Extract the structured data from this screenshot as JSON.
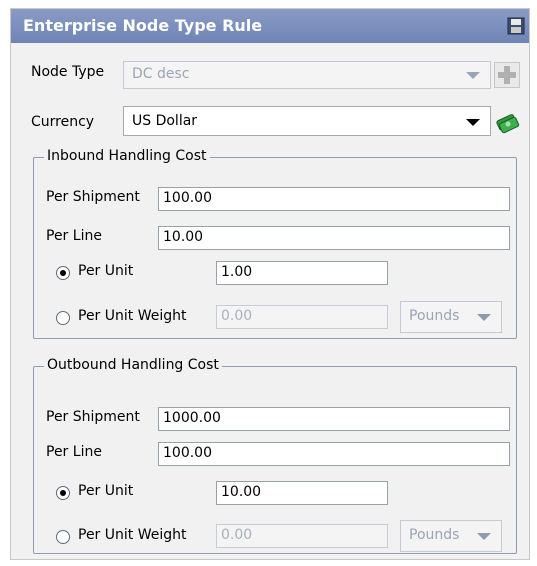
{
  "title": "Enterprise Node Type Rule",
  "node_type": {
    "label": "Node Type",
    "value": "DC desc"
  },
  "currency": {
    "label": "Currency",
    "value": "US Dollar"
  },
  "inbound": {
    "legend": "Inbound Handling Cost",
    "per_shipment_label": "Per Shipment",
    "per_shipment_value": "100.00",
    "per_line_label": "Per Line",
    "per_line_value": "10.00",
    "per_unit_label": "Per Unit",
    "per_unit_value": "1.00",
    "per_unit_weight_label": "Per Unit Weight",
    "per_unit_weight_value": "0.00",
    "weight_unit": "Pounds"
  },
  "outbound": {
    "legend": "Outbound Handling Cost",
    "per_shipment_label": "Per Shipment",
    "per_shipment_value": "1000.00",
    "per_line_label": "Per Line",
    "per_line_value": "100.00",
    "per_unit_label": "Per Unit",
    "per_unit_value": "10.00",
    "per_unit_weight_label": "Per Unit Weight",
    "per_unit_weight_value": "0.00",
    "weight_unit": "Pounds"
  },
  "colors": {
    "titlebar": "#7a8dbd",
    "panel": "#f1f1f1",
    "group_border": "#8e9db3"
  }
}
